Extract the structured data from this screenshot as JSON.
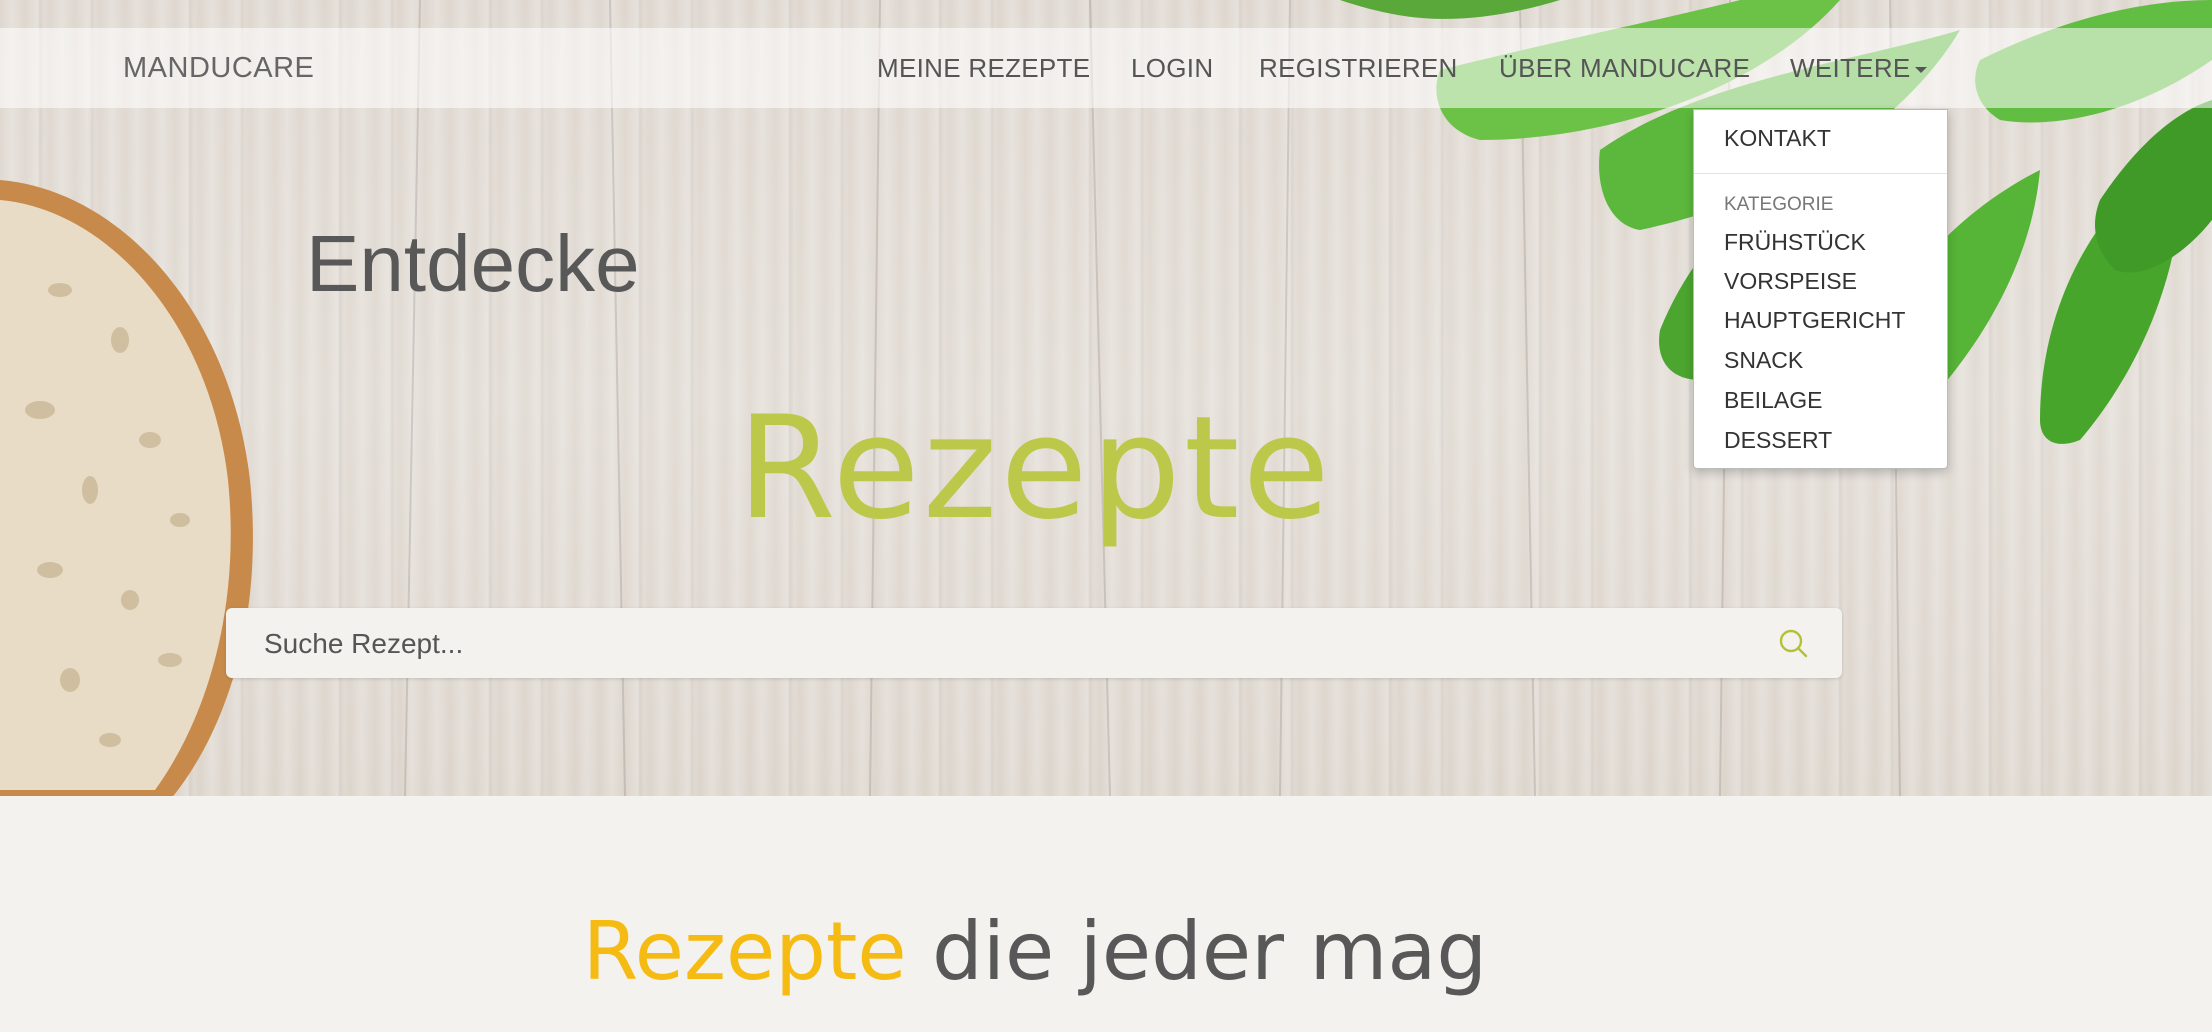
{
  "navbar": {
    "brand": "MANDUCARE",
    "items": [
      {
        "label": "MEINE REZEPTE"
      },
      {
        "label": "LOGIN"
      },
      {
        "label": "REGISTRIEREN"
      },
      {
        "label": "ÜBER MANDUCARE"
      },
      {
        "label": "WEITERE"
      }
    ]
  },
  "dropdown": {
    "contact": "KONTAKT",
    "category_header": "KATEGORIE",
    "categories": [
      "FRÜHSTÜCK",
      "VORSPEISE",
      "HAUPTGERICHT",
      "SNACK",
      "BEILAGE",
      "DESSERT"
    ]
  },
  "hero": {
    "subtitle": "Entdecke",
    "title": "Rezepte"
  },
  "search": {
    "placeholder": "Suche Rezept...",
    "icon": "search-icon"
  },
  "section": {
    "title_accent": "Rezepte",
    "title_rest": " die jeder mag"
  },
  "colors": {
    "hero_title": "#bcc84a",
    "accent": "#f5bb12",
    "text": "#585858"
  }
}
